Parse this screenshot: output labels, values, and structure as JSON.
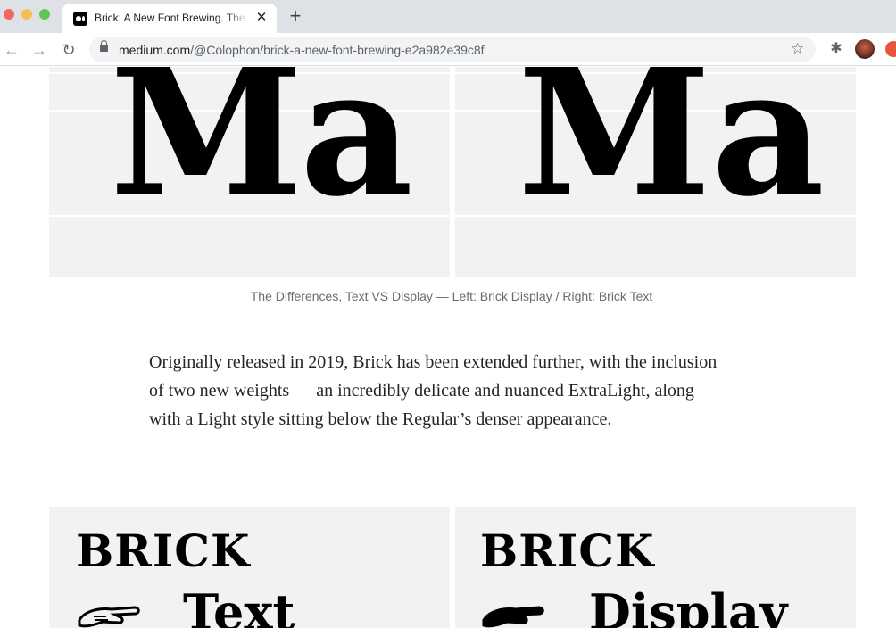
{
  "browser": {
    "tab_title": "Brick; A New Font Brewing. The Differences, Text VS Display",
    "tab_close": "✕",
    "new_tab": "+",
    "nav_back": "←",
    "nav_forward": "→",
    "reload": "↻",
    "url_domain": "medium.com",
    "url_path": "/@Colophon/brick-a-new-font-brewing-e2a982e39c8f",
    "bookmark": "☆",
    "extensions": "✱"
  },
  "article": {
    "figure1": {
      "left_glyphs": "Ma",
      "right_glyphs": "Ma",
      "caption": "The Differences, Text VS Display — Left: Brick Display / Right: Brick Text"
    },
    "paragraph": "Originally released in 2019, Brick has been extended further, with the inclusion of two new weights — an incredibly delicate and nuanced ExtraLight, along with a Light style sitting below the Regular’s denser appearance.",
    "figure2": {
      "left_title": "BRICK",
      "left_style": "Text",
      "right_title": "BRICK",
      "right_style": "Display"
    }
  }
}
